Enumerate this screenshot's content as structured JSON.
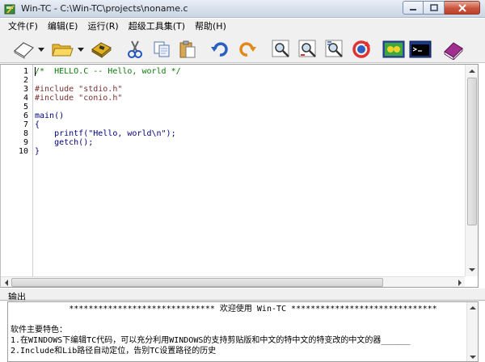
{
  "window": {
    "title": "Win-TC - C:\\Win-TC\\projects\\noname.c"
  },
  "menu": {
    "items": [
      "文件(F)",
      "编辑(E)",
      "运行(R)",
      "超级工具集(T)",
      "帮助(H)"
    ]
  },
  "toolbar": {
    "buttons": [
      {
        "name": "new-file",
        "icon": "new-document-icon"
      },
      {
        "name": "open-file",
        "icon": "open-folder-icon"
      },
      {
        "name": "save-file",
        "icon": "save-icon"
      },
      {
        "name": "cut",
        "icon": "scissors-icon"
      },
      {
        "name": "copy",
        "icon": "copy-icon"
      },
      {
        "name": "paste",
        "icon": "paste-icon"
      },
      {
        "name": "undo",
        "icon": "undo-icon"
      },
      {
        "name": "redo",
        "icon": "redo-icon"
      },
      {
        "name": "find",
        "icon": "magnifier-icon"
      },
      {
        "name": "find-next",
        "icon": "magnifier-next-icon"
      },
      {
        "name": "replace",
        "icon": "magnifier-replace-icon"
      },
      {
        "name": "refresh",
        "icon": "refresh-icon"
      },
      {
        "name": "compile",
        "icon": "compile-icon"
      },
      {
        "name": "run",
        "icon": "console-icon"
      },
      {
        "name": "help",
        "icon": "help-book-icon"
      }
    ]
  },
  "editor": {
    "line_numbers": [
      "1",
      "2",
      "3",
      "4",
      "5",
      "6",
      "7",
      "8",
      "9",
      "10"
    ],
    "lines": [
      {
        "text": "/*  HELLO.C -- Hello, world */",
        "kind": "comment"
      },
      {
        "text": "",
        "kind": "plain"
      },
      {
        "text": "#include \"stdio.h\"",
        "kind": "dir"
      },
      {
        "text": "#include \"conio.h\"",
        "kind": "dir"
      },
      {
        "text": "",
        "kind": "plain"
      },
      {
        "text": "main()",
        "kind": "plain"
      },
      {
        "text": "{",
        "kind": "plain"
      },
      {
        "text": "    printf(\"Hello, world\\n\");",
        "kind": "plain"
      },
      {
        "text": "    getch();",
        "kind": "plain"
      },
      {
        "text": "}",
        "kind": "plain"
      }
    ]
  },
  "output": {
    "title": "输出",
    "lines": [
      "            ****************************** 欢迎使用 Win-TC ******************************",
      "",
      "软件主要特色：",
      "1.在WINDOWS下编辑TC代码，可以充分利用WINDOWS的支持剪贴版和中文的特中文的特变改的中文的器______",
      "2.Include和Lib路径自动定位，告别TC设置路径的历史"
    ]
  },
  "colors": {
    "comment": "#0b7a0b",
    "directive": "#7a3030",
    "code": "#000080",
    "close_button": "#c9543d"
  }
}
